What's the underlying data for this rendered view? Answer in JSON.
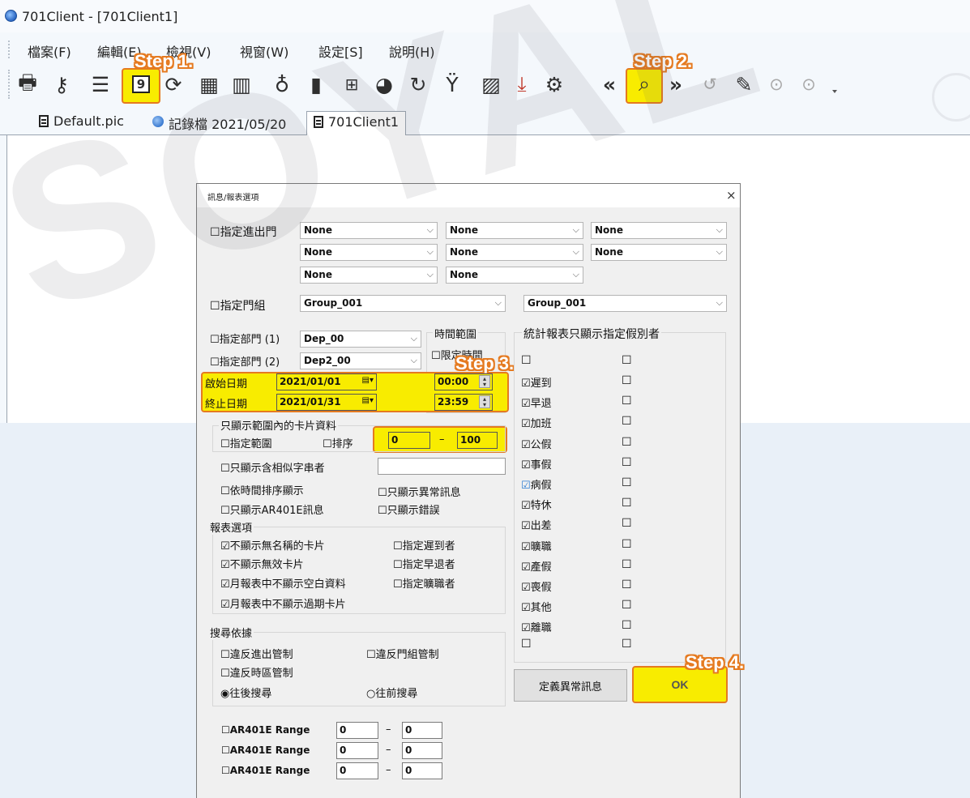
{
  "window": {
    "title": "701Client - [701Client1]"
  },
  "menu": [
    "檔案(F)",
    "編輯(E)",
    "檢視(V)",
    "視窗(W)",
    "設定[S]",
    "說明(H)"
  ],
  "toolbar": {
    "icons": [
      "print-icon",
      "key-icon",
      "report-list-icon",
      "calendar-9-icon",
      "refresh-icon",
      "calendar-grid-icon",
      "bar-chart-icon",
      "user-outline-icon",
      "door-icon",
      "123-icon",
      "pie-icon",
      "sync-icon",
      "cocktail-icon",
      "image-icon",
      "download-icon",
      "gear-icon",
      "prev-icon",
      "search-icon",
      "next-icon",
      "undo-icon",
      "pin-icon",
      "play-icon",
      "stop-icon"
    ],
    "highlighted": [
      "calendar-9-icon",
      "search-icon"
    ]
  },
  "steps": {
    "step1": "Step 1.",
    "step2": "Step 2.",
    "step3": "Step 3.",
    "step4": "Step 4."
  },
  "tabs": [
    "Default.pic",
    "記錄檔 2021/05/20",
    "701Client1"
  ],
  "watermark": "SOYAL",
  "dialog": {
    "title": "訊息/報表選項",
    "close": "×",
    "door": {
      "label": "指定進出門",
      "combos": [
        "None",
        "None",
        "None",
        "None",
        "None",
        "None",
        "None",
        "None"
      ]
    },
    "group": {
      "label": "指定門組",
      "combos": [
        "Group_001",
        "Group_001"
      ]
    },
    "dept1": {
      "label": "指定部門 (1)",
      "value": "Dep_00"
    },
    "dept2": {
      "label": "指定部門 (2)",
      "value": "Dep2_00"
    },
    "time_range": {
      "title": "時間範圍",
      "limit": "限定時間"
    },
    "start": {
      "label": "啟始日期",
      "date": "2021/01/01",
      "time": "00:00"
    },
    "end": {
      "label": "終止日期",
      "date": "2021/01/31",
      "time": "23:59"
    },
    "card_range": {
      "title": "只顯示範圍內的卡片資料",
      "specify": "指定範圍",
      "sort": "排序",
      "from": "0",
      "dash": "–",
      "to": "100"
    },
    "filters": {
      "similar": "只顯示含相似字串者",
      "by_time": "依時間排序顯示",
      "abnormal": "只顯示異常訊息",
      "ar401e": "只顯示AR401E訊息",
      "errors": "只顯示錯誤"
    },
    "report_options": {
      "title": "報表選項",
      "items": [
        "不顯示無名稱的卡片",
        "不顯示無效卡片",
        "月報表中不顯示空白資料",
        "月報表中不顯示過期卡片"
      ],
      "right": [
        "指定遲到者",
        "指定早退者",
        "指定曠職者"
      ]
    },
    "search": {
      "title": "搜尋依據",
      "door_violation": "違反進出管制",
      "group_violation": "違反門組管制",
      "zone_violation": "違反時區管制",
      "backward": "往後搜尋",
      "forward": "往前搜尋"
    },
    "leave": {
      "title": "統計報表只顯示指定假別者",
      "items": [
        "遲到",
        "早退",
        "加班",
        "公假",
        "事假",
        "病假",
        "特休",
        "出差",
        "曠職",
        "產假",
        "喪假",
        "其他",
        "離職"
      ]
    },
    "ar_ranges": [
      {
        "label": "AR401E Range",
        "from": "0",
        "to": "0"
      },
      {
        "label": "AR401E Range",
        "from": "0",
        "to": "0"
      },
      {
        "label": "AR401E Range",
        "from": "0",
        "to": "0"
      }
    ],
    "define_abnormal": "定義異常訊息",
    "ok": "OK"
  },
  "colors": {
    "highlight": "#f8ec00",
    "highlight_border": "#e57a20"
  }
}
